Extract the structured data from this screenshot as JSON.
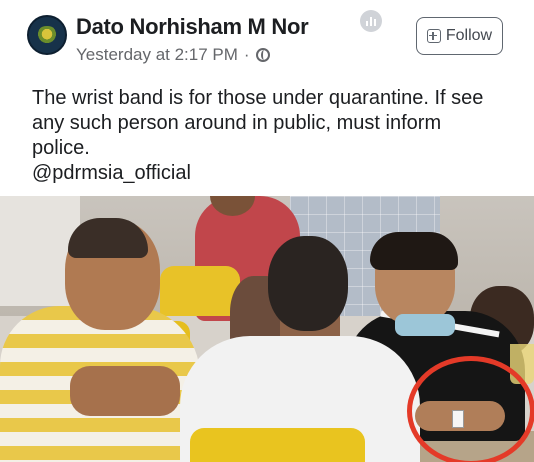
{
  "post": {
    "author": "Dato Norhisham M Nor",
    "time": "Yesterday at 2:17 PM",
    "separator": "·",
    "follow_label": "Follow",
    "text_line1": "The wrist band is for those under quarantine. If see any such person around in public, must inform police.",
    "text_line2": "@pdrmsia_official"
  },
  "icons": {
    "avatar": "page-avatar",
    "privacy": "globe-icon",
    "stats": "stats-icon",
    "follow": "follow-plus-icon"
  },
  "colors": {
    "highlight_circle": "#e43a28",
    "author_text": "#1c1e21",
    "meta_text": "#65676b"
  }
}
